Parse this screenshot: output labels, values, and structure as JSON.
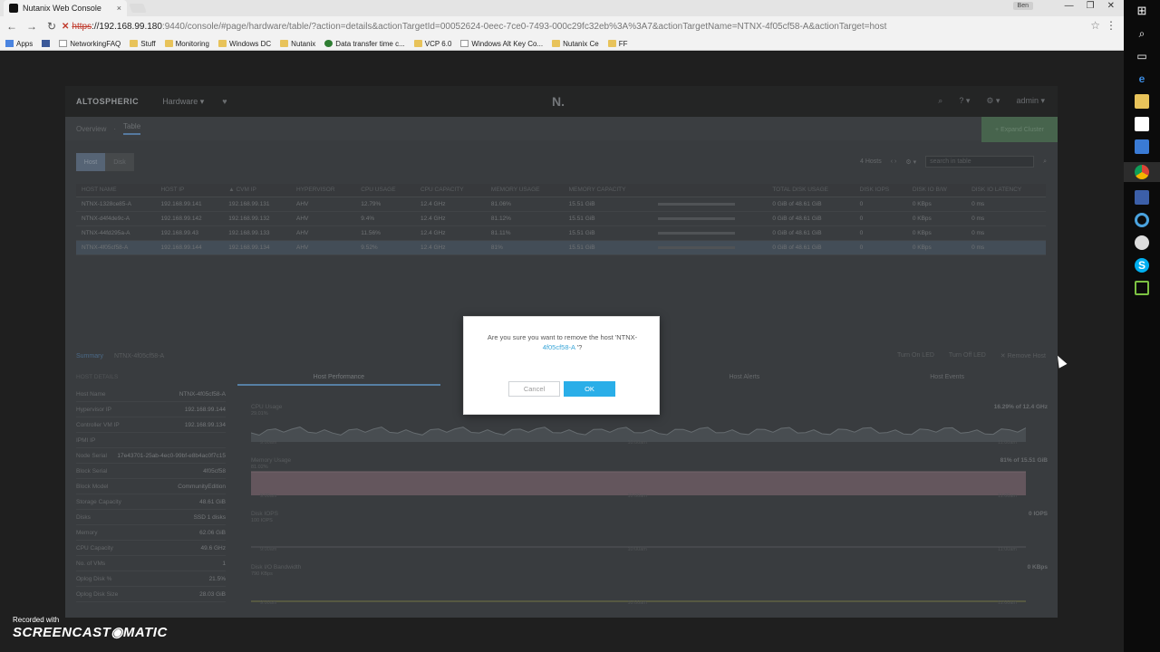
{
  "browser": {
    "tab_title": "Nutanix Web Console",
    "tab_close": "×",
    "window_controls": [
      "—",
      "❐",
      "✕"
    ],
    "user_chip": "Ben",
    "url_scheme": "https",
    "url_host": "://192.168.99.180",
    "url_path": ":9440/console/#page/hardware/table/?action=details&actionTargetId=00052624-0eec-7ce0-7493-000c29fc32eb%3A%3A7&actionTargetName=NTNX-4f05cf58-A&actionTarget=host",
    "bookmarks": [
      {
        "label": "Apps",
        "icon": "grid-icon"
      },
      {
        "label": "",
        "icon": "facebook-icon"
      },
      {
        "label": "NetworkingFAQ",
        "icon": "page-icon"
      },
      {
        "label": "Stuff",
        "icon": "folder-icon"
      },
      {
        "label": "Monitoring",
        "icon": "folder-icon"
      },
      {
        "label": "Windows DC",
        "icon": "folder-icon"
      },
      {
        "label": "Nutanix",
        "icon": "folder-icon"
      },
      {
        "label": "Data transfer time c...",
        "icon": "calc-icon"
      },
      {
        "label": "VCP 6.0",
        "icon": "folder-icon"
      },
      {
        "label": "Windows Alt Key Co...",
        "icon": "page-icon"
      },
      {
        "label": "Nutanix Ce",
        "icon": "folder-icon"
      },
      {
        "label": "FF",
        "icon": "folder-icon"
      }
    ]
  },
  "console": {
    "cluster_name": "ALTOSPHERIC",
    "menu": "Hardware",
    "logo": "N.",
    "user": "admin",
    "subnav": [
      "Overview",
      "·",
      "Table"
    ],
    "action_button": "+ Expand Cluster",
    "toggle": [
      "Host",
      "Disk"
    ],
    "host_count": "4 Hosts",
    "search_placeholder": "search in table",
    "table": {
      "headers": [
        "HOST NAME",
        "HOST IP",
        "▲ CVM IP",
        "HYPERVISOR",
        "CPU USAGE",
        "CPU CAPACITY",
        "MEMORY USAGE",
        "MEMORY CAPACITY",
        "",
        "TOTAL DISK USAGE",
        "DISK IOPS",
        "DISK IO B/W",
        "DISK IO LATENCY"
      ],
      "rows": [
        [
          "NTNX-1328ce85-A",
          "192.168.99.141",
          "192.168.99.131",
          "AHV",
          "12.79%",
          "12.4 GHz",
          "81.06%",
          "15.51 GiB",
          "",
          "0 GiB of 48.61 GiB",
          "0",
          "0 KBps",
          "0 ms"
        ],
        [
          "NTNX-d4f4de9c-A",
          "192.168.99.142",
          "192.168.99.132",
          "AHV",
          "9.4%",
          "12.4 GHz",
          "81.12%",
          "15.51 GiB",
          "",
          "0 GiB of 48.61 GiB",
          "0",
          "0 KBps",
          "0 ms"
        ],
        [
          "NTNX-44fd295a-A",
          "192.168.99.43",
          "192.168.99.133",
          "AHV",
          "11.56%",
          "12.4 GHz",
          "81.11%",
          "15.51 GiB",
          "",
          "0 GiB of 48.61 GiB",
          "0",
          "0 KBps",
          "0 ms"
        ],
        [
          "NTNX-4f05cf58-A",
          "192.168.99.144",
          "192.168.99.134",
          "AHV",
          "9.52%",
          "12.4 GHz",
          "81%",
          "15.51 GiB",
          "",
          "0 GiB of 48.61 GiB",
          "0",
          "0 KBps",
          "0 ms"
        ]
      ],
      "selected_row": 3
    },
    "detail": {
      "summary_label": "Summary",
      "host_name": "NTNX-4f05cf58-A",
      "actions": [
        "Turn On LED",
        "Turn Off LED",
        "✕ Remove Host"
      ],
      "section_title": "HOST DETAILS",
      "rows": [
        [
          "Host Name",
          "NTNX-4f05cf58-A"
        ],
        [
          "Hypervisor IP",
          "192.168.99.144"
        ],
        [
          "Controller VM IP",
          "192.168.99.134"
        ],
        [
          "IPMI IP",
          ""
        ],
        [
          "Node Serial",
          "17e43701-25ab-4ec0-99bf-e8b4ac0f7c15"
        ],
        [
          "Block Serial",
          "4f05cf58"
        ],
        [
          "Block Model",
          "CommunityEdition"
        ],
        [
          "Storage Capacity",
          "48.61 GiB"
        ],
        [
          "Disks",
          "SSD  1 disks"
        ],
        [
          "Memory",
          "62.06 GiB"
        ],
        [
          "CPU Capacity",
          "49.6 GHz"
        ],
        [
          "No. of VMs",
          "1"
        ],
        [
          "Oplog Disk %",
          "21.5%"
        ],
        [
          "Oplog Disk Size",
          "28.03 GiB"
        ]
      ],
      "perf_tabs": [
        "Host Performance",
        "",
        "Host Alerts",
        "Host Events"
      ],
      "charts": [
        {
          "title": "CPU Usage",
          "sub": "29.01%",
          "value": "16.29% of 12.4 GHz",
          "ticks": [
            "9:00am",
            "10:00am",
            "11:00am"
          ]
        },
        {
          "title": "Memory Usage",
          "sub": "81.02%",
          "value": "81% of 15.51 GiB",
          "ticks": [
            "9:00am",
            "10:00am",
            "11:00am"
          ]
        },
        {
          "title": "Disk IOPS",
          "sub": "100 IOPS",
          "value": "0 IOPS",
          "ticks": [
            "9:00am",
            "10:00am",
            "11:00am"
          ]
        },
        {
          "title": "Disk I/O Bandwidth",
          "sub": "790 KBps",
          "value": "0 KBps",
          "ticks": [
            "9:00am",
            "10:00am",
            "11:00am"
          ]
        }
      ]
    }
  },
  "dialog": {
    "message_prefix": "Are you sure you want to remove the host 'NTNX-",
    "message_host": "4f05cf58-A",
    "message_suffix": "'?",
    "cancel": "Cancel",
    "ok": "OK"
  },
  "watermark": {
    "line1": "Recorded with",
    "brand": "SCREENCAST◉MATIC"
  },
  "colors": {
    "ok_button": "#2aaee8",
    "accent": "#3aa6d8",
    "overlay": "#3d4043"
  }
}
